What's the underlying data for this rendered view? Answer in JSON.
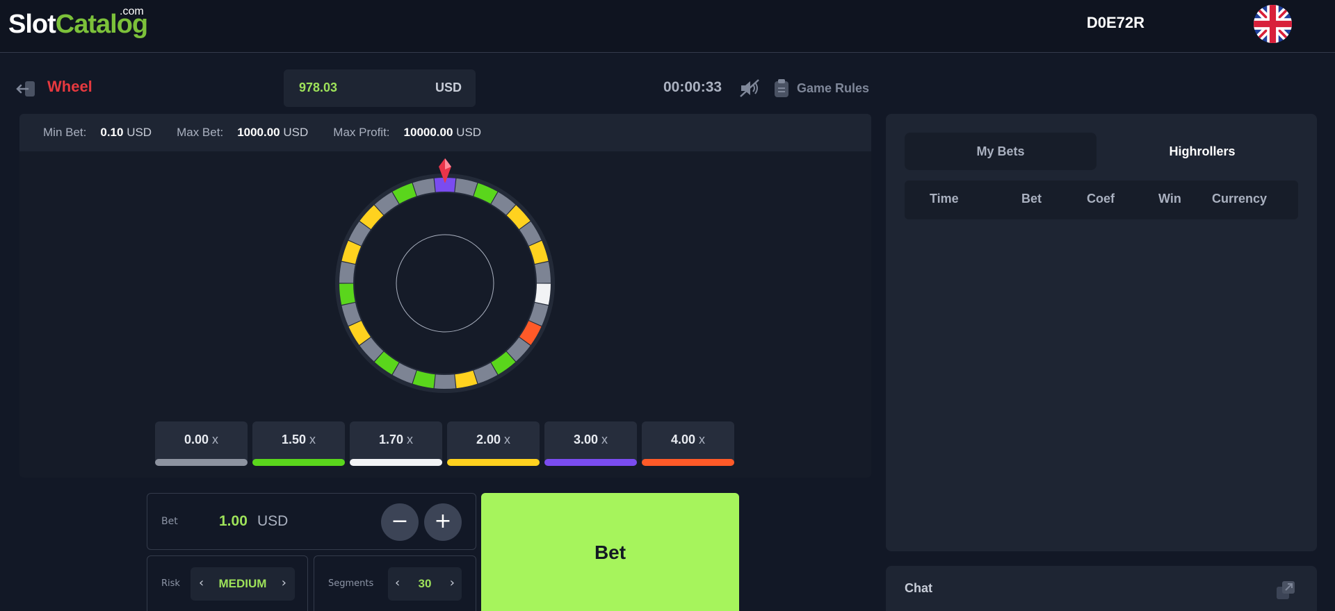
{
  "topbar": {
    "logo_main": "Slot",
    "logo_accent": "Catalog",
    "logo_suffix": ".com",
    "user_id": "D0E72R",
    "language_icon": "uk-flag-icon"
  },
  "game_header": {
    "title": "Wheel",
    "balance_amount": "978.03",
    "balance_currency": "USD",
    "timer": "00:00:33",
    "rules_label": "Game Rules"
  },
  "limits": {
    "min_label": "Min Bet:",
    "min_value": "0.10",
    "min_currency": "USD",
    "max_label": "Max Bet:",
    "max_value": "1000.00",
    "max_currency": "USD",
    "profit_label": "Max Profit:",
    "profit_value": "10000.00",
    "profit_currency": "USD"
  },
  "wheel": {
    "segment_count": 30,
    "segments": [
      "purple",
      "gray",
      "green",
      "gray",
      "yellow",
      "gray",
      "yellow",
      "gray",
      "white",
      "gray",
      "orange",
      "gray",
      "green",
      "gray",
      "yellow",
      "gray",
      "green",
      "gray",
      "green",
      "gray",
      "yellow",
      "gray",
      "green",
      "gray",
      "yellow",
      "gray",
      "yellow",
      "gray",
      "green",
      "gray"
    ],
    "colors": {
      "gray": "#7d8494",
      "green": "#5ad61c",
      "yellow": "#ffd21f",
      "white": "#f2f3f5",
      "orange": "#ff5a28",
      "purple": "#7a4cf0",
      "pointer": "#e8344a"
    }
  },
  "multipliers": [
    {
      "value": "0.00",
      "suffix": "x",
      "color": "#8d93a0"
    },
    {
      "value": "1.50",
      "suffix": "x",
      "color": "#5ad61c"
    },
    {
      "value": "1.70",
      "suffix": "x",
      "color": "#f2f3f5"
    },
    {
      "value": "2.00",
      "suffix": "x",
      "color": "#ffd21f"
    },
    {
      "value": "3.00",
      "suffix": "x",
      "color": "#7a4cf0"
    },
    {
      "value": "4.00",
      "suffix": "x",
      "color": "#ff5a28"
    }
  ],
  "bet": {
    "label": "Bet",
    "amount": "1.00",
    "currency": "USD",
    "minus": "−",
    "plus": "+",
    "button_label": "Bet"
  },
  "risk": {
    "label": "Risk",
    "value": "MEDIUM",
    "prev": "‹",
    "next": "›"
  },
  "segments_control": {
    "label": "Segments",
    "value": "30",
    "prev": "‹",
    "next": "›"
  },
  "side_panel": {
    "tabs": [
      "My Bets",
      "Highrollers"
    ],
    "columns": [
      "Time",
      "Bet",
      "Coef",
      "Win",
      "Currency"
    ]
  },
  "chat": {
    "title": "Chat"
  }
}
